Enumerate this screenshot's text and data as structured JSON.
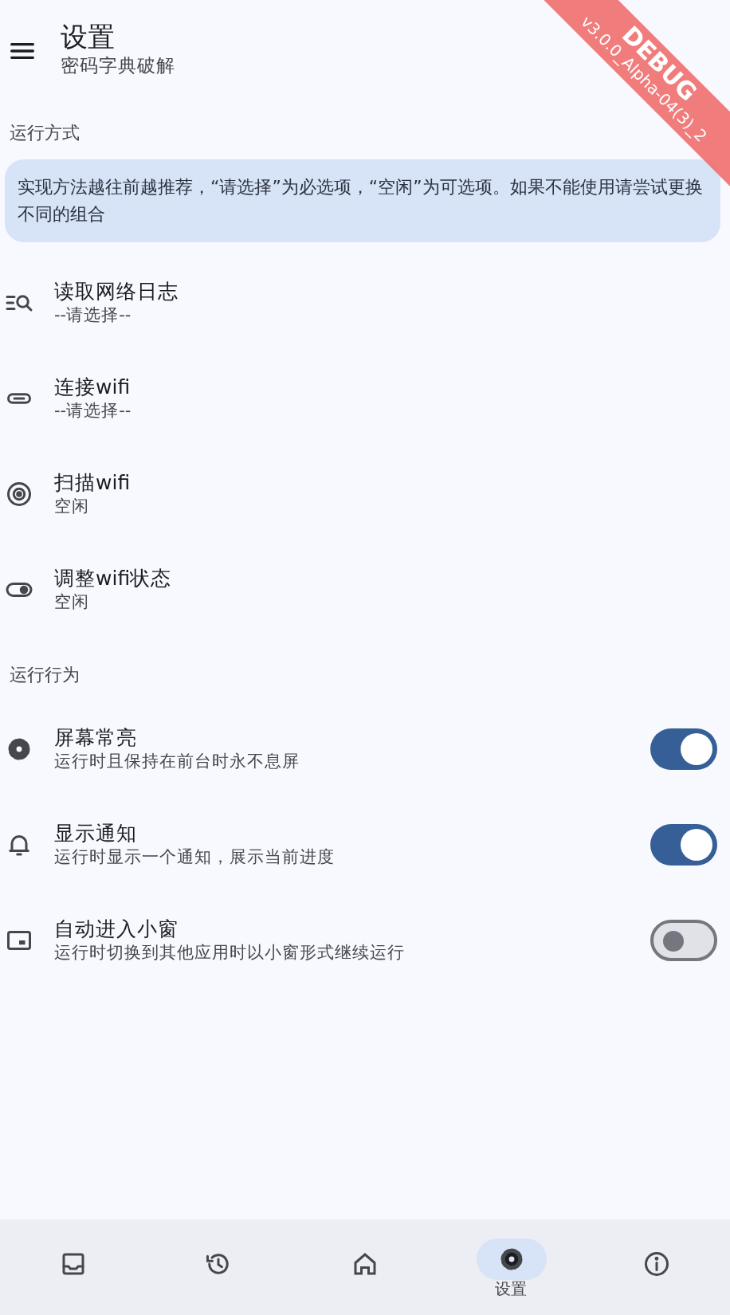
{
  "app_bar": {
    "title": "设置",
    "subtitle": "密码字典破解"
  },
  "debug_banner": {
    "label": "DEBUG",
    "version": "v3.0.0_Alpha-04(3)_2"
  },
  "sections": [
    {
      "title": "运行方式",
      "note": "实现方法越往前越推荐，“请选择”为必选项，“空闲”为可选项。如果不能使用请尝试更换不同的组合",
      "items": [
        {
          "kind": "option",
          "title": "读取网络日志",
          "subtitle": "--请选择--"
        },
        {
          "kind": "option",
          "title": "连接wifi",
          "subtitle": "--请选择--"
        },
        {
          "kind": "option",
          "title": "扫描wifi",
          "subtitle": "空闲"
        },
        {
          "kind": "option",
          "title": "调整wifi状态",
          "subtitle": "空闲"
        }
      ]
    },
    {
      "title": "运行行为",
      "items": [
        {
          "kind": "switch",
          "title": "屏幕常亮",
          "subtitle": "运行时且保持在前台时永不息屏",
          "on": true
        },
        {
          "kind": "switch",
          "title": "显示通知",
          "subtitle": "运行时显示一个通知，展示当前进度",
          "on": true
        },
        {
          "kind": "switch",
          "title": "自动进入小窗",
          "subtitle": "运行时切换到其他应用时以小窗形式继续运行",
          "on": false
        }
      ]
    }
  ],
  "bottom_nav": [
    {
      "selected": false
    },
    {
      "selected": false
    },
    {
      "selected": false
    },
    {
      "selected": true,
      "label": "设置"
    },
    {
      "selected": false
    }
  ]
}
